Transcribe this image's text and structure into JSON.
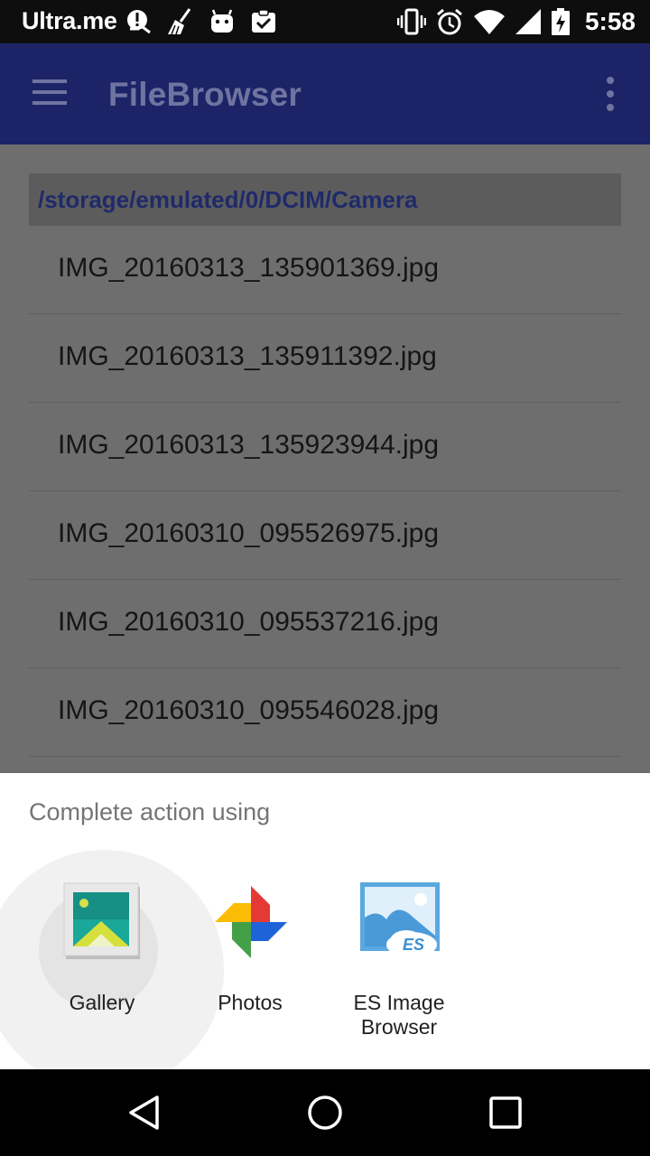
{
  "status_bar": {
    "carrier": "Ultra.me",
    "time": "5:58",
    "left_icons": [
      "alert-bug-icon",
      "broom-icon",
      "android-icon",
      "clipboard-check-icon"
    ],
    "right_icons": [
      "vibrate-icon",
      "alarm-icon",
      "wifi-icon",
      "signal-icon",
      "battery-charging-icon"
    ]
  },
  "app_bar": {
    "title": "FileBrowser",
    "menu_icon": "hamburger-menu-icon",
    "overflow_icon": "more-vert-icon",
    "color": "#1c2467"
  },
  "path": "/storage/emulated/0/DCIM/Camera",
  "files": [
    "IMG_20160313_135901369.jpg",
    "IMG_20160313_135911392.jpg",
    "IMG_20160313_135923944.jpg",
    "IMG_20160310_095526975.jpg",
    "IMG_20160310_095537216.jpg",
    "IMG_20160310_095546028.jpg"
  ],
  "chooser": {
    "title": "Complete action using",
    "apps": [
      {
        "label": "Gallery",
        "icon": "gallery-app-icon"
      },
      {
        "label": "Photos",
        "icon": "photos-pinwheel-icon"
      },
      {
        "label": "ES Image Browser",
        "icon": "es-image-browser-icon"
      }
    ]
  },
  "nav_bar": {
    "buttons": [
      "back-triangle-icon",
      "home-circle-icon",
      "recents-square-icon"
    ]
  }
}
